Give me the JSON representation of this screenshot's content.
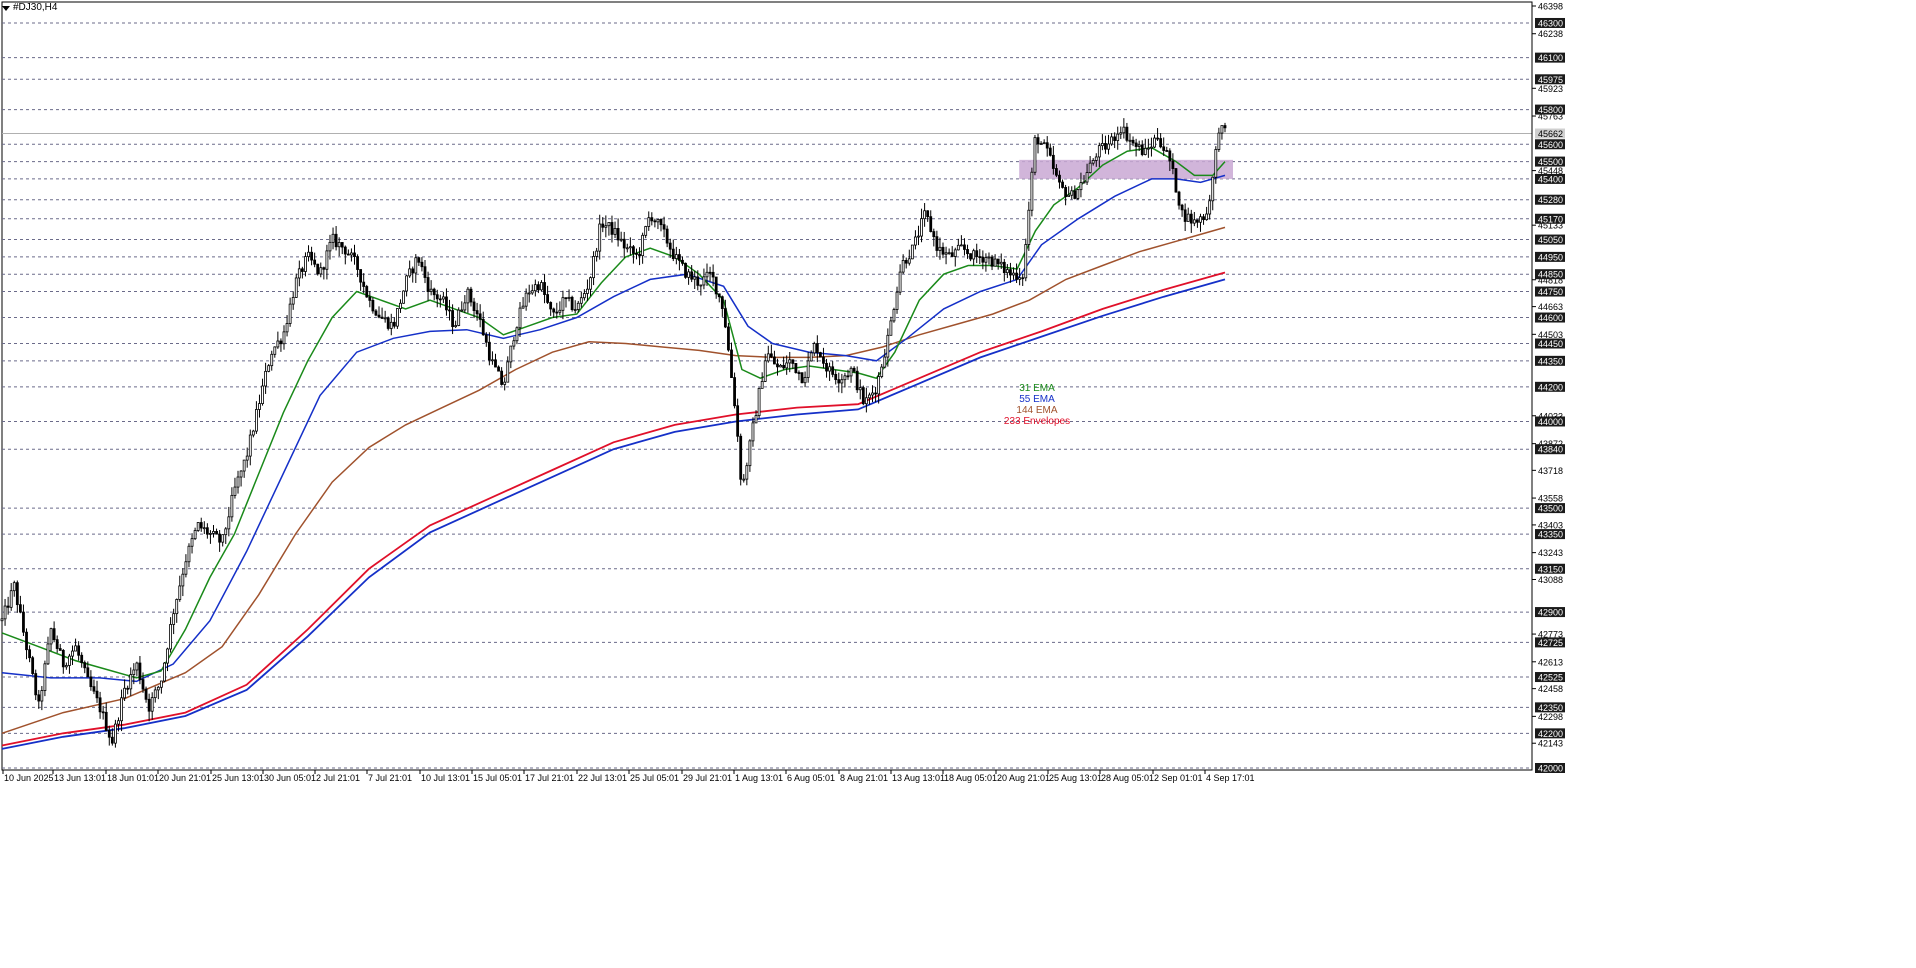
{
  "window": {
    "symbol_label": "#DJ30,H4"
  },
  "colors": {
    "background": "#ffffff",
    "grid": "#6b6b8a",
    "candle": "#000000",
    "ema31": "#1a8a1a",
    "ema55": "#1530c8",
    "ema144": "#a0522d",
    "env_upper": "#e0102a",
    "env_lower": "#1530c8",
    "zone": "#c9a8d3",
    "price_tag_bg": "#ffffff",
    "price_tag_hl": "#1a1a1a"
  },
  "legend": [
    {
      "label": "31 EMA",
      "color": "#1a8a1a"
    },
    {
      "label": "55 EMA",
      "color": "#1530c8"
    },
    {
      "label": "144 EMA",
      "color": "#a0522d"
    },
    {
      "label": "233 Envelopes",
      "color": "#e0102a"
    }
  ],
  "chart_data": {
    "type": "candlestick",
    "symbol": "#DJ30",
    "timeframe": "H4",
    "ylim": [
      42000,
      46398
    ],
    "current_price": 45662,
    "dashed_levels": [
      46300,
      46100,
      45975,
      45800,
      45600,
      45500,
      45400,
      45280,
      45170,
      45050,
      44950,
      44850,
      44750,
      44600,
      44450,
      44350,
      44200,
      44000,
      43840,
      43500,
      43350,
      43150,
      42900,
      42725,
      42525,
      42350,
      42200,
      42000
    ],
    "highlighted_levels": [
      46300,
      46100,
      45975,
      45800,
      45662,
      45600,
      45500,
      45400,
      45280,
      45170,
      45050,
      44950,
      44850,
      44750,
      44600,
      44450,
      44350,
      44200,
      44000,
      43840,
      43500,
      43350,
      43150,
      42900,
      42725,
      42525,
      42350,
      42200,
      42000
    ],
    "plain_ticks": [
      46398,
      46238,
      45923,
      45763,
      45448,
      45133,
      44818,
      44663,
      44503,
      44033,
      43872,
      43718,
      43558,
      43403,
      43243,
      43088,
      42773,
      42613,
      42458,
      42298,
      42143
    ],
    "x_ticks": [
      "10 Jun 2025",
      "13 Jun 13:01",
      "18 Jun 01:01",
      "20 Jun 21:01",
      "25 Jun 13:01",
      "30 Jun 05:01",
      "2 Jul 21:01",
      "7 Jul 21:01",
      "10 Jul 13:01",
      "15 Jul 05:01",
      "17 Jul 21:01",
      "22 Jul 13:01",
      "25 Jul 05:01",
      "29 Jul 21:01",
      "1 Aug 13:01",
      "6 Aug 05:01",
      "8 Aug 21:01",
      "13 Aug 13:01",
      "18 Aug 05:01",
      "20 Aug 21:01",
      "25 Aug 13:01",
      "28 Aug 05:01",
      "2 Sep 01:01",
      "4 Sep 17:01"
    ],
    "zone": {
      "from": 45400,
      "to": 45510,
      "x_start_index": 0.835,
      "x_end_index": 1.0
    },
    "close_path": [
      [
        0.0,
        42850
      ],
      [
        0.01,
        43050
      ],
      [
        0.02,
        42700
      ],
      [
        0.03,
        42350
      ],
      [
        0.04,
        42800
      ],
      [
        0.05,
        42600
      ],
      [
        0.06,
        42700
      ],
      [
        0.07,
        42500
      ],
      [
        0.08,
        42350
      ],
      [
        0.09,
        42150
      ],
      [
        0.1,
        42450
      ],
      [
        0.11,
        42600
      ],
      [
        0.12,
        42350
      ],
      [
        0.13,
        42500
      ],
      [
        0.14,
        42900
      ],
      [
        0.15,
        43200
      ],
      [
        0.16,
        43400
      ],
      [
        0.17,
        43350
      ],
      [
        0.18,
        43300
      ],
      [
        0.19,
        43600
      ],
      [
        0.2,
        43800
      ],
      [
        0.21,
        44100
      ],
      [
        0.22,
        44400
      ],
      [
        0.23,
        44500
      ],
      [
        0.24,
        44800
      ],
      [
        0.25,
        44950
      ],
      [
        0.26,
        44850
      ],
      [
        0.27,
        45050
      ],
      [
        0.28,
        45000
      ],
      [
        0.29,
        44900
      ],
      [
        0.3,
        44700
      ],
      [
        0.31,
        44600
      ],
      [
        0.32,
        44550
      ],
      [
        0.33,
        44800
      ],
      [
        0.34,
        44950
      ],
      [
        0.35,
        44750
      ],
      [
        0.36,
        44700
      ],
      [
        0.37,
        44550
      ],
      [
        0.38,
        44750
      ],
      [
        0.39,
        44600
      ],
      [
        0.4,
        44350
      ],
      [
        0.41,
        44200
      ],
      [
        0.42,
        44550
      ],
      [
        0.43,
        44750
      ],
      [
        0.44,
        44800
      ],
      [
        0.45,
        44600
      ],
      [
        0.46,
        44700
      ],
      [
        0.47,
        44650
      ],
      [
        0.48,
        44800
      ],
      [
        0.49,
        45150
      ],
      [
        0.5,
        45100
      ],
      [
        0.51,
        45000
      ],
      [
        0.52,
        44950
      ],
      [
        0.53,
        45200
      ],
      [
        0.54,
        45100
      ],
      [
        0.55,
        44950
      ],
      [
        0.56,
        44850
      ],
      [
        0.57,
        44800
      ],
      [
        0.58,
        44850
      ],
      [
        0.59,
        44650
      ],
      [
        0.6,
        44050
      ],
      [
        0.605,
        43600
      ],
      [
        0.615,
        44000
      ],
      [
        0.625,
        44400
      ],
      [
        0.635,
        44300
      ],
      [
        0.645,
        44350
      ],
      [
        0.655,
        44250
      ],
      [
        0.665,
        44450
      ],
      [
        0.675,
        44300
      ],
      [
        0.685,
        44250
      ],
      [
        0.695,
        44300
      ],
      [
        0.705,
        44100
      ],
      [
        0.715,
        44200
      ],
      [
        0.725,
        44500
      ],
      [
        0.735,
        44900
      ],
      [
        0.745,
        45000
      ],
      [
        0.755,
        45200
      ],
      [
        0.765,
        45000
      ],
      [
        0.775,
        44950
      ],
      [
        0.785,
        45000
      ],
      [
        0.795,
        44950
      ],
      [
        0.805,
        44950
      ],
      [
        0.815,
        44900
      ],
      [
        0.825,
        44850
      ],
      [
        0.835,
        44850
      ],
      [
        0.845,
        45650
      ],
      [
        0.855,
        45550
      ],
      [
        0.865,
        45350
      ],
      [
        0.875,
        45300
      ],
      [
        0.885,
        45400
      ],
      [
        0.895,
        45550
      ],
      [
        0.905,
        45600
      ],
      [
        0.915,
        45700
      ],
      [
        0.925,
        45600
      ],
      [
        0.935,
        45550
      ],
      [
        0.945,
        45650
      ],
      [
        0.955,
        45500
      ],
      [
        0.965,
        45200
      ],
      [
        0.975,
        45150
      ],
      [
        0.985,
        45200
      ],
      [
        0.99,
        45400
      ],
      [
        0.995,
        45700
      ],
      [
        1.0,
        45662
      ]
    ],
    "ema31": [
      [
        0.0,
        42780
      ],
      [
        0.03,
        42700
      ],
      [
        0.06,
        42620
      ],
      [
        0.09,
        42560
      ],
      [
        0.11,
        42520
      ],
      [
        0.13,
        42560
      ],
      [
        0.15,
        42800
      ],
      [
        0.17,
        43100
      ],
      [
        0.19,
        43350
      ],
      [
        0.21,
        43700
      ],
      [
        0.23,
        44050
      ],
      [
        0.25,
        44350
      ],
      [
        0.27,
        44600
      ],
      [
        0.29,
        44750
      ],
      [
        0.31,
        44700
      ],
      [
        0.33,
        44650
      ],
      [
        0.35,
        44700
      ],
      [
        0.37,
        44650
      ],
      [
        0.39,
        44600
      ],
      [
        0.41,
        44500
      ],
      [
        0.43,
        44550
      ],
      [
        0.45,
        44600
      ],
      [
        0.47,
        44620
      ],
      [
        0.49,
        44800
      ],
      [
        0.51,
        44950
      ],
      [
        0.53,
        45000
      ],
      [
        0.55,
        44950
      ],
      [
        0.57,
        44850
      ],
      [
        0.59,
        44700
      ],
      [
        0.605,
        44300
      ],
      [
        0.62,
        44250
      ],
      [
        0.64,
        44300
      ],
      [
        0.66,
        44320
      ],
      [
        0.68,
        44300
      ],
      [
        0.7,
        44280
      ],
      [
        0.715,
        44250
      ],
      [
        0.73,
        44400
      ],
      [
        0.75,
        44700
      ],
      [
        0.77,
        44850
      ],
      [
        0.79,
        44900
      ],
      [
        0.81,
        44900
      ],
      [
        0.83,
        44880
      ],
      [
        0.845,
        45100
      ],
      [
        0.86,
        45250
      ],
      [
        0.88,
        45350
      ],
      [
        0.9,
        45480
      ],
      [
        0.92,
        45560
      ],
      [
        0.94,
        45580
      ],
      [
        0.96,
        45500
      ],
      [
        0.975,
        45420
      ],
      [
        0.99,
        45420
      ],
      [
        1.0,
        45500
      ]
    ],
    "ema55": [
      [
        0.0,
        42550
      ],
      [
        0.04,
        42520
      ],
      [
        0.08,
        42520
      ],
      [
        0.11,
        42500
      ],
      [
        0.14,
        42600
      ],
      [
        0.17,
        42850
      ],
      [
        0.2,
        43250
      ],
      [
        0.23,
        43700
      ],
      [
        0.26,
        44150
      ],
      [
        0.29,
        44400
      ],
      [
        0.32,
        44480
      ],
      [
        0.35,
        44520
      ],
      [
        0.38,
        44530
      ],
      [
        0.41,
        44480
      ],
      [
        0.44,
        44530
      ],
      [
        0.47,
        44600
      ],
      [
        0.5,
        44720
      ],
      [
        0.53,
        44820
      ],
      [
        0.56,
        44850
      ],
      [
        0.59,
        44780
      ],
      [
        0.61,
        44550
      ],
      [
        0.63,
        44450
      ],
      [
        0.66,
        44400
      ],
      [
        0.69,
        44380
      ],
      [
        0.715,
        44350
      ],
      [
        0.74,
        44480
      ],
      [
        0.77,
        44650
      ],
      [
        0.8,
        44750
      ],
      [
        0.83,
        44820
      ],
      [
        0.85,
        45020
      ],
      [
        0.88,
        45170
      ],
      [
        0.91,
        45300
      ],
      [
        0.94,
        45400
      ],
      [
        0.96,
        45400
      ],
      [
        0.98,
        45380
      ],
      [
        1.0,
        45420
      ]
    ],
    "ema144": [
      [
        0.0,
        42200
      ],
      [
        0.05,
        42320
      ],
      [
        0.1,
        42400
      ],
      [
        0.15,
        42550
      ],
      [
        0.18,
        42700
      ],
      [
        0.21,
        43000
      ],
      [
        0.24,
        43350
      ],
      [
        0.27,
        43650
      ],
      [
        0.3,
        43850
      ],
      [
        0.33,
        43980
      ],
      [
        0.36,
        44080
      ],
      [
        0.39,
        44180
      ],
      [
        0.42,
        44300
      ],
      [
        0.45,
        44400
      ],
      [
        0.48,
        44460
      ],
      [
        0.51,
        44450
      ],
      [
        0.54,
        44430
      ],
      [
        0.57,
        44410
      ],
      [
        0.6,
        44380
      ],
      [
        0.63,
        44370
      ],
      [
        0.66,
        44370
      ],
      [
        0.69,
        44380
      ],
      [
        0.72,
        44430
      ],
      [
        0.75,
        44500
      ],
      [
        0.78,
        44560
      ],
      [
        0.81,
        44620
      ],
      [
        0.84,
        44700
      ],
      [
        0.87,
        44820
      ],
      [
        0.9,
        44900
      ],
      [
        0.93,
        44980
      ],
      [
        0.96,
        45040
      ],
      [
        0.98,
        45080
      ],
      [
        1.0,
        45120
      ]
    ],
    "env_upper": [
      [
        0.0,
        42130
      ],
      [
        0.05,
        42200
      ],
      [
        0.1,
        42250
      ],
      [
        0.15,
        42320
      ],
      [
        0.2,
        42480
      ],
      [
        0.25,
        42800
      ],
      [
        0.3,
        43150
      ],
      [
        0.35,
        43400
      ],
      [
        0.4,
        43560
      ],
      [
        0.45,
        43720
      ],
      [
        0.5,
        43880
      ],
      [
        0.55,
        43980
      ],
      [
        0.6,
        44040
      ],
      [
        0.65,
        44080
      ],
      [
        0.7,
        44100
      ],
      [
        0.75,
        44250
      ],
      [
        0.8,
        44400
      ],
      [
        0.85,
        44520
      ],
      [
        0.9,
        44650
      ],
      [
        0.95,
        44760
      ],
      [
        1.0,
        44860
      ]
    ],
    "env_lower": [
      [
        0.0,
        42110
      ],
      [
        0.05,
        42180
      ],
      [
        0.1,
        42230
      ],
      [
        0.15,
        42300
      ],
      [
        0.2,
        42450
      ],
      [
        0.25,
        42760
      ],
      [
        0.3,
        43100
      ],
      [
        0.35,
        43360
      ],
      [
        0.4,
        43520
      ],
      [
        0.45,
        43680
      ],
      [
        0.5,
        43840
      ],
      [
        0.55,
        43940
      ],
      [
        0.6,
        44000
      ],
      [
        0.65,
        44040
      ],
      [
        0.7,
        44070
      ],
      [
        0.75,
        44220
      ],
      [
        0.8,
        44370
      ],
      [
        0.85,
        44490
      ],
      [
        0.9,
        44610
      ],
      [
        0.95,
        44720
      ],
      [
        1.0,
        44820
      ]
    ]
  }
}
